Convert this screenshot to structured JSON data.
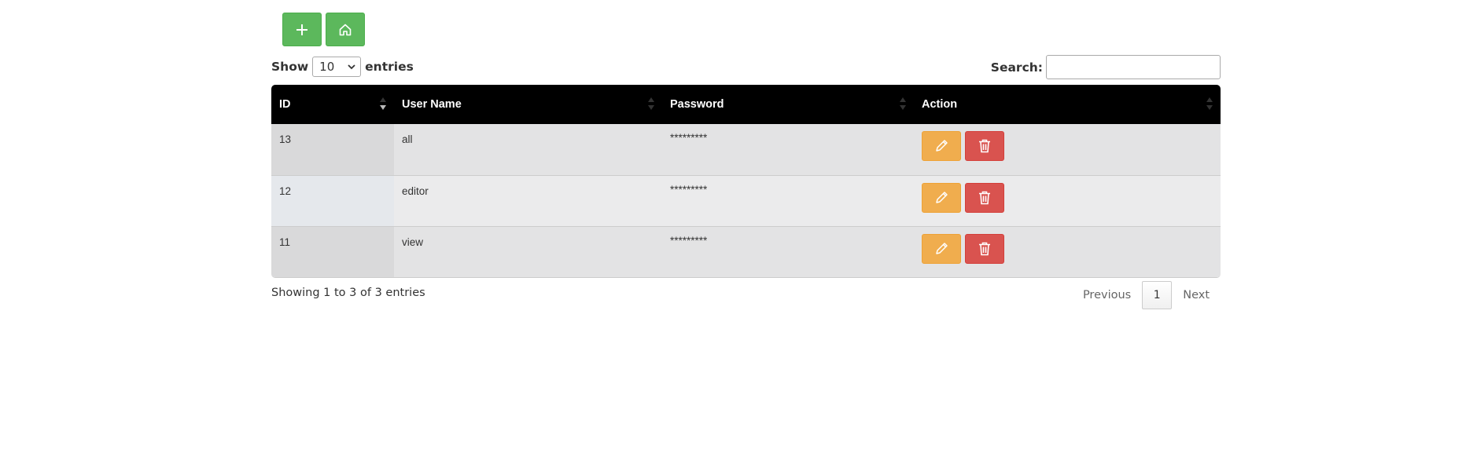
{
  "toolbar": {
    "add_icon": "plus-icon",
    "home_icon": "home-icon",
    "color": "#5cb85c"
  },
  "length": {
    "show_label": "Show",
    "value": "10",
    "entries_label": "entries"
  },
  "search": {
    "label": "Search:",
    "value": ""
  },
  "table": {
    "columns": [
      "ID",
      "User Name",
      "Password",
      "Action"
    ],
    "rows": [
      {
        "id": "13",
        "username": "all",
        "password": "*********"
      },
      {
        "id": "12",
        "username": "editor",
        "password": "*********"
      },
      {
        "id": "11",
        "username": "view",
        "password": "*********"
      }
    ],
    "edit_color": "#f0ad4e",
    "delete_color": "#d9534f"
  },
  "footer": {
    "info": "Showing 1 to 3 of 3 entries",
    "previous": "Previous",
    "page": "1",
    "next": "Next"
  }
}
